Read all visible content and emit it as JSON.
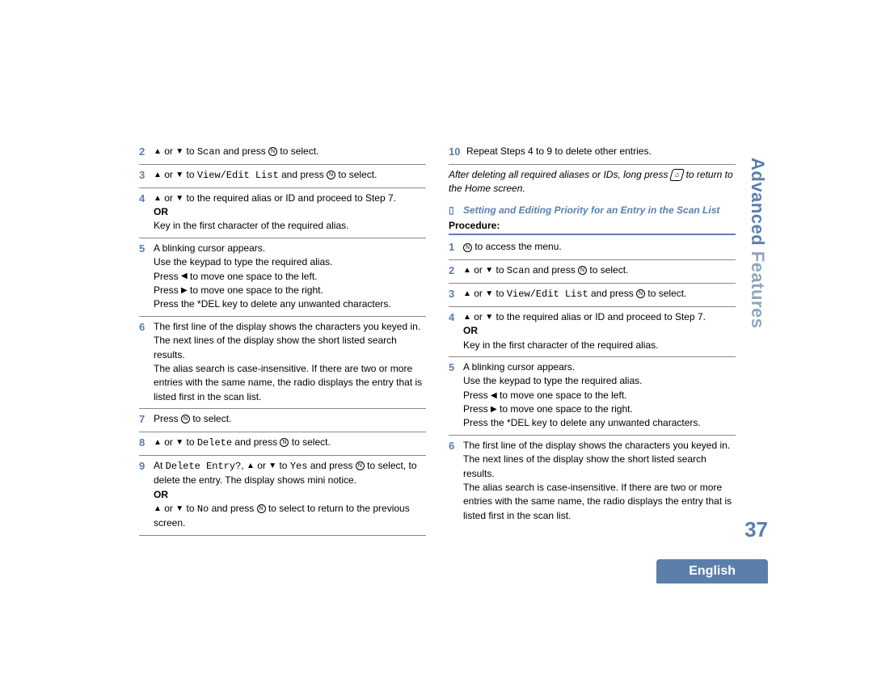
{
  "side_title_a": "Advanced",
  "side_title_b": " Features",
  "page_number": "37",
  "language": "English",
  "left": {
    "s2": {
      "n": "2",
      "pre": " or ",
      "mid": " to ",
      "code": "Scan",
      "post1": " and press ",
      "post2": " to select."
    },
    "s3": {
      "n": "3",
      "pre": " or ",
      "mid": " to ",
      "code": "View/Edit List",
      "post1": " and press ",
      "post2": " to select."
    },
    "s4": {
      "n": "4",
      "line1a": " or ",
      "line1b": " to the required alias or ID and proceed to Step 7.",
      "or": "OR",
      "line2": "Key in the first character of the required alias."
    },
    "s5": {
      "n": "5",
      "l1": "A blinking cursor appears.",
      "l2": "Use the keypad to type the required alias.",
      "l3a": "Press ",
      "l3b": " to move one space to the left.",
      "l4a": "Press ",
      "l4b": " to move one space to the right.",
      "l5": "Press the *DEL key to delete any unwanted characters."
    },
    "s6": {
      "n": "6",
      "l1": "The first line of the display shows the characters you keyed in. The next lines of the display show the short listed search results.",
      "l2": "The alias search is case-insensitive. If there are two or more entries with the same name, the radio displays the entry that is listed first in the scan list."
    },
    "s7": {
      "n": "7",
      "pre": "Press ",
      "post": " to select."
    },
    "s8": {
      "n": "8",
      "pre": " or ",
      "mid": " to ",
      "code": "Delete",
      "post1": " and press ",
      "post2": " to select."
    },
    "s9": {
      "n": "9",
      "l1a": "At ",
      "code1": "Delete Entry?",
      "l1b": ", ",
      "l1c": " or ",
      "l1d": " to ",
      "code2": "Yes",
      "l1e": " and press ",
      "l1f": " to select, to delete the entry. The display shows mini notice.",
      "or": "OR",
      "l2a": " or ",
      "l2b": " to ",
      "code3": "No",
      "l2c": " and press ",
      "l2d": " to select to return to the previous screen."
    }
  },
  "right": {
    "s10": {
      "n": "10",
      "text": "Repeat Steps 4 to 9 to delete other entries."
    },
    "note": {
      "a": "After deleting all required aliases or IDs, long press ",
      "home": "⌂",
      "b": " to return to the Home screen."
    },
    "section": "Setting and Editing Priority for an Entry in the Scan List",
    "procedure": "Procedure:",
    "s1": {
      "n": "1",
      "a": " to access the menu."
    },
    "s2": {
      "n": "2",
      "pre": " or ",
      "mid": " to ",
      "code": "Scan",
      "post1": " and press ",
      "post2": " to select."
    },
    "s3": {
      "n": "3",
      "pre": " or ",
      "mid": " to ",
      "code": "View/Edit List",
      "post1": " and press ",
      "post2": " to select."
    },
    "s4": {
      "n": "4",
      "line1a": " or ",
      "line1b": " to the required alias or ID and proceed to Step 7.",
      "or": "OR",
      "line2": "Key in the first character of the required alias."
    },
    "s5": {
      "n": "5",
      "l1": "A blinking cursor appears.",
      "l2": "Use the keypad to type the required alias.",
      "l3a": "Press ",
      "l3b": " to move one space to the left.",
      "l4a": "Press ",
      "l4b": " to move one space to the right.",
      "l5": "Press the *DEL key to delete any unwanted characters."
    },
    "s6": {
      "n": "6",
      "l1": "The first line of the display shows the characters you keyed in. The next lines of the display show the short listed search results.",
      "l2": "The alias search is case-insensitive. If there are two or more entries with the same name, the radio displays the entry that is listed first in the scan list."
    }
  }
}
